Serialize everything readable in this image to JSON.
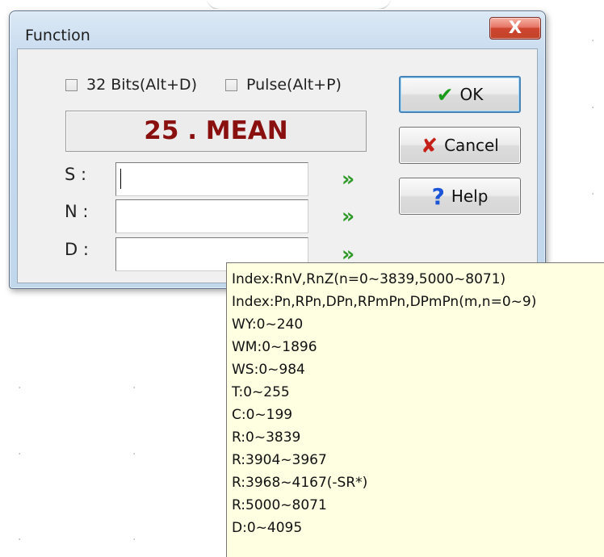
{
  "window": {
    "title": "Function",
    "close_label": "X"
  },
  "options": {
    "bits_label": "32 Bits(Alt+D)",
    "bits_checked": false,
    "pulse_label": "Pulse(Alt+P)",
    "pulse_checked": false
  },
  "function_name": "25 . MEAN",
  "fields": [
    {
      "label": "S :",
      "value": ""
    },
    {
      "label": "N :",
      "value": ""
    },
    {
      "label": "D :",
      "value": ""
    }
  ],
  "buttons": {
    "ok_label": "OK",
    "cancel_label": "Cancel",
    "help_label": "Help"
  },
  "expand_glyph": "»",
  "tooltip": {
    "lines": [
      "Index:RnV,RnZ(n=0~3839,5000~8071)",
      "Index:Pn,RPn,DPn,RPmPn,DPmPn(m,n=0~9)",
      "WY:0~240",
      "WM:0~1896",
      "WS:0~984",
      "T:0~255",
      "C:0~199",
      "R:0~3839",
      "R:3904~3967",
      "R:3968~4167(-SR*)",
      "R:5000~8071",
      "D:0~4095"
    ]
  },
  "colors": {
    "accent_ok": "#1b9b1b",
    "accent_cancel": "#c52018",
    "accent_help": "#1d55d8",
    "function_text": "#8a1010",
    "tooltip_bg": "#ffffe1"
  }
}
